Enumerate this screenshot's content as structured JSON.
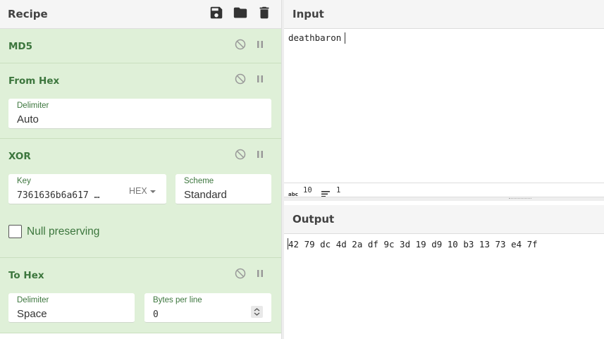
{
  "recipe": {
    "title": "Recipe",
    "toolbar_icons": [
      "save-icon",
      "folder-icon",
      "trash-icon"
    ]
  },
  "operations": {
    "md5": {
      "name": "MD5"
    },
    "from_hex": {
      "name": "From Hex",
      "delimiter_label": "Delimiter",
      "delimiter_value": "Auto"
    },
    "xor": {
      "name": "XOR",
      "key_label": "Key",
      "key_value": "7361636b6a617 …",
      "key_format": "HEX",
      "scheme_label": "Scheme",
      "scheme_value": "Standard",
      "null_preserving_label": "Null preserving",
      "null_preserving_checked": false
    },
    "to_hex": {
      "name": "To Hex",
      "delimiter_label": "Delimiter",
      "delimiter_value": "Space",
      "bytes_per_line_label": "Bytes per line",
      "bytes_per_line_value": "0"
    }
  },
  "input": {
    "title": "Input",
    "text": "deathbaron",
    "length": "10",
    "lines": "1"
  },
  "output": {
    "title": "Output",
    "text": "42 79 dc 4d 2a df 9c 3d 19 d9 10 b3 13 73 e4 7f"
  },
  "colors": {
    "operation_bg": "#dff0d8",
    "operation_text": "#3c763d",
    "header_bg": "#f5f5f5"
  }
}
